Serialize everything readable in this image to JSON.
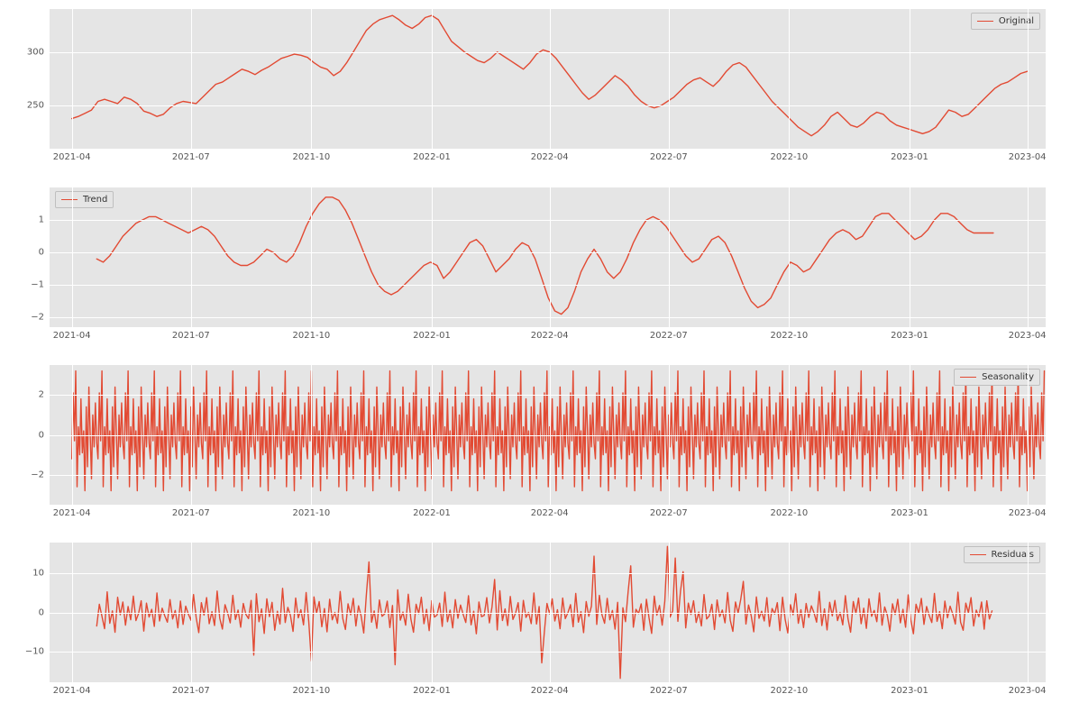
{
  "chart_data": [
    {
      "type": "line",
      "legend": "Original",
      "xlabel": "",
      "ylabel": "",
      "xticks": [
        "2021-04",
        "2021-07",
        "2021-10",
        "2022-01",
        "2022-04",
        "2022-07",
        "2022-10",
        "2023-01",
        "2023-04"
      ],
      "yticks": [
        250,
        300
      ],
      "xlim": [
        "2021-03-15",
        "2023-04-15"
      ],
      "ylim": [
        210,
        340
      ],
      "x_step_days": 5,
      "x_start": "2021-04-01",
      "values": [
        238,
        240,
        243,
        246,
        254,
        256,
        254,
        252,
        258,
        256,
        252,
        245,
        243,
        240,
        242,
        248,
        252,
        254,
        253,
        252,
        258,
        264,
        270,
        272,
        276,
        280,
        284,
        282,
        279,
        283,
        286,
        290,
        294,
        296,
        298,
        297,
        295,
        290,
        286,
        284,
        278,
        282,
        290,
        300,
        310,
        320,
        326,
        330,
        332,
        334,
        330,
        325,
        322,
        326,
        332,
        334,
        330,
        320,
        310,
        305,
        300,
        296,
        292,
        290,
        294,
        300,
        296,
        292,
        288,
        284,
        290,
        298,
        302,
        300,
        294,
        286,
        278,
        270,
        262,
        256,
        260,
        266,
        272,
        278,
        274,
        268,
        260,
        254,
        250,
        248,
        250,
        254,
        258,
        264,
        270,
        274,
        276,
        272,
        268,
        274,
        282,
        288,
        290,
        286,
        278,
        270,
        262,
        254,
        248,
        242,
        236,
        230,
        226,
        222,
        226,
        232,
        240,
        244,
        238,
        232,
        230,
        234,
        240,
        244,
        242,
        236,
        232,
        230,
        228,
        226,
        224,
        226,
        230,
        238,
        246,
        244,
        240,
        242,
        248,
        254,
        260,
        266,
        270,
        272,
        276,
        280,
        282
      ]
    },
    {
      "type": "line",
      "legend": "Trend",
      "xlabel": "",
      "ylabel": "",
      "xticks": [
        "2021-04",
        "2021-07",
        "2021-10",
        "2022-01",
        "2022-04",
        "2022-07",
        "2022-10",
        "2023-01",
        "2023-04"
      ],
      "yticks": [
        -2,
        -1,
        0,
        1
      ],
      "xlim": [
        "2021-03-15",
        "2023-04-15"
      ],
      "ylim": [
        -2.3,
        2.0
      ],
      "x_step_days": 5,
      "x_start": "2021-04-20",
      "values": [
        -0.2,
        -0.3,
        -0.1,
        0.2,
        0.5,
        0.7,
        0.9,
        1.0,
        1.1,
        1.1,
        1.0,
        0.9,
        0.8,
        0.7,
        0.6,
        0.7,
        0.8,
        0.7,
        0.5,
        0.2,
        -0.1,
        -0.3,
        -0.4,
        -0.4,
        -0.3,
        -0.1,
        0.1,
        0.0,
        -0.2,
        -0.3,
        -0.1,
        0.3,
        0.8,
        1.2,
        1.5,
        1.7,
        1.7,
        1.6,
        1.3,
        0.9,
        0.4,
        -0.1,
        -0.6,
        -1.0,
        -1.2,
        -1.3,
        -1.2,
        -1.0,
        -0.8,
        -0.6,
        -0.4,
        -0.3,
        -0.4,
        -0.8,
        -0.6,
        -0.3,
        0.0,
        0.3,
        0.4,
        0.2,
        -0.2,
        -0.6,
        -0.4,
        -0.2,
        0.1,
        0.3,
        0.2,
        -0.2,
        -0.8,
        -1.4,
        -1.8,
        -1.9,
        -1.7,
        -1.2,
        -0.6,
        -0.2,
        0.1,
        -0.2,
        -0.6,
        -0.8,
        -0.6,
        -0.2,
        0.3,
        0.7,
        1.0,
        1.1,
        1.0,
        0.8,
        0.5,
        0.2,
        -0.1,
        -0.3,
        -0.2,
        0.1,
        0.4,
        0.5,
        0.3,
        -0.1,
        -0.6,
        -1.1,
        -1.5,
        -1.7,
        -1.6,
        -1.4,
        -1.0,
        -0.6,
        -0.3,
        -0.4,
        -0.6,
        -0.5,
        -0.2,
        0.1,
        0.4,
        0.6,
        0.7,
        0.6,
        0.4,
        0.5,
        0.8,
        1.1,
        1.2,
        1.2,
        1.0,
        0.8,
        0.6,
        0.4,
        0.5,
        0.7,
        1.0,
        1.2,
        1.2,
        1.1,
        0.9,
        0.7,
        0.6,
        0.6,
        0.6,
        0.6
      ]
    },
    {
      "type": "line",
      "legend": "Seasonality",
      "xlabel": "",
      "ylabel": "",
      "xticks": [
        "2021-04",
        "2021-07",
        "2021-10",
        "2022-01",
        "2022-04",
        "2022-07",
        "2022-10",
        "2023-01",
        "2023-04"
      ],
      "yticks": [
        -2,
        0,
        2
      ],
      "xlim": [
        "2021-03-15",
        "2023-04-15"
      ],
      "ylim": [
        -3.5,
        3.5
      ],
      "x_step_days": 1,
      "x_start": "2021-04-01",
      "period": 20,
      "period_values": [
        -1.2,
        2.1,
        -0.3,
        3.2,
        -2.6,
        0.4,
        -1.0,
        1.8,
        -0.9,
        0.2,
        -2.8,
        1.4,
        -1.6,
        2.4,
        0.1,
        -2.2,
        1.0,
        -0.6,
        1.6,
        -0.4
      ]
    },
    {
      "type": "line",
      "legend": "Residuals",
      "xlabel": "",
      "ylabel": "",
      "xticks": [
        "2021-04",
        "2021-07",
        "2021-10",
        "2022-01",
        "2022-04",
        "2022-07",
        "2022-10",
        "2023-01",
        "2023-04"
      ],
      "yticks": [
        -10,
        0,
        10
      ],
      "xlim": [
        "2021-03-15",
        "2023-04-15"
      ],
      "ylim": [
        -18,
        18
      ],
      "x_step_days": 2,
      "x_start": "2021-04-20",
      "values": [
        -3.5,
        2.1,
        -1.0,
        -4.2,
        5.3,
        -2.8,
        0.4,
        -5.1,
        3.9,
        -0.6,
        2.7,
        -3.3,
        1.5,
        -1.9,
        4.2,
        -2.1,
        -0.3,
        3.0,
        -4.8,
        2.4,
        -1.2,
        0.8,
        -3.6,
        5.0,
        -2.2,
        1.1,
        -0.9,
        -2.5,
        3.3,
        -1.7,
        0.5,
        -4.0,
        2.9,
        -3.1,
        1.6,
        -0.4,
        -2.0,
        4.6,
        -1.3,
        -5.2,
        2.5,
        -0.7,
        3.8,
        -2.9,
        0.2,
        -3.4,
        5.5,
        -1.5,
        -4.3,
        2.0,
        -0.1,
        -2.7,
        4.4,
        -1.8,
        0.6,
        -3.8,
        2.3,
        -0.5,
        -1.6,
        3.1,
        -11.0,
        4.8,
        -2.4,
        0.9,
        -5.4,
        3.5,
        -1.1,
        2.6,
        -4.6,
        0.3,
        -3.0,
        6.2,
        -2.6,
        1.3,
        -0.8,
        -4.9,
        3.7,
        -1.4,
        0.7,
        -3.2,
        5.1,
        -2.3,
        -12.5,
        4.0,
        -0.2,
        2.8,
        -3.7,
        1.0,
        -5.0,
        3.4,
        -1.9,
        0.0,
        -2.8,
        5.4,
        -1.6,
        -4.4,
        2.2,
        -0.6,
        3.6,
        -3.5,
        1.7,
        -0.9,
        -5.3,
        4.5,
        13.0,
        -2.5,
        0.4,
        -4.1,
        3.2,
        -1.0,
        -0.4,
        2.9,
        -3.9,
        1.8,
        -13.5,
        5.8,
        -2.0,
        0.1,
        -3.3,
        4.7,
        -1.7,
        -5.1,
        2.1,
        -0.3,
        3.9,
        -2.9,
        0.8,
        -4.7,
        3.0,
        -1.2,
        -0.7,
        2.4,
        -3.6,
        5.2,
        -2.4,
        0.6,
        -4.0,
        3.3,
        -1.5,
        1.9,
        -0.5,
        -2.6,
        4.3,
        -3.2,
        0.3,
        -5.5,
        2.7,
        -1.1,
        -0.8,
        3.8,
        -2.7,
        1.4,
        8.5,
        -4.5,
        5.6,
        -2.1,
        0.9,
        -3.4,
        4.1,
        -1.8,
        -0.2,
        2.5,
        -4.8,
        3.1,
        -1.3,
        0.0,
        -2.9,
        5.0,
        -3.0,
        1.5,
        -13.0,
        -5.0,
        2.3,
        -0.4,
        3.5,
        -2.2,
        0.7,
        -4.2,
        3.7,
        -1.6,
        -0.1,
        2.0,
        -3.7,
        4.9,
        -2.5,
        0.2,
        -5.2,
        2.8,
        -1.0,
        1.6,
        14.5,
        -3.1,
        4.4,
        -0.6,
        -2.8,
        3.6,
        -1.9,
        0.5,
        -4.3,
        2.6,
        -17.0,
        1.2,
        -2.4,
        5.3,
        12.0,
        -3.8,
        0.8,
        -0.3,
        2.2,
        -4.6,
        3.4,
        -1.4,
        -5.4,
        4.2,
        -0.7,
        1.8,
        -3.3,
        2.9,
        17.0,
        -1.2,
        0.4,
        14.0,
        -2.3,
        5.5,
        10.5,
        -4.0,
        2.4,
        -0.5,
        3.0,
        -2.6,
        0.1,
        -3.5,
        4.6,
        -1.7,
        -0.9,
        2.1,
        -4.4,
        3.2,
        -1.1,
        0.6,
        -2.7,
        5.1,
        -2.0,
        -4.9,
        2.7,
        -0.2,
        3.3,
        8.0,
        -3.0,
        1.9,
        -0.8,
        -5.0,
        4.0,
        -1.5,
        0.3,
        -2.2,
        3.8,
        -3.6,
        1.0,
        -0.4,
        2.5,
        -4.7,
        3.9,
        -1.8,
        -5.3,
        2.0,
        -0.6,
        4.8,
        -2.8,
        0.7,
        -3.9,
        2.3,
        -1.3,
        1.7,
        -0.1,
        -2.5,
        5.4,
        -3.4,
        0.9,
        -4.5,
        2.6,
        -0.9,
        3.1,
        -2.1,
        0.0,
        -3.2,
        4.3,
        -1.6,
        -5.1,
        2.8,
        -0.3,
        3.7,
        -2.9,
        1.1,
        -4.1,
        3.5,
        -1.0,
        0.5,
        -2.4,
        5.0,
        -3.3,
        1.4,
        -0.7,
        -4.8,
        2.2,
        -0.5,
        3.4,
        -2.7,
        0.8,
        -3.8,
        4.5,
        -1.9,
        -5.5,
        2.1,
        -0.2,
        3.6,
        -3.1,
        1.5,
        -0.8,
        -2.6,
        4.9,
        -2.3,
        0.2,
        -4.2,
        2.9,
        -1.4,
        1.6,
        -0.4,
        -3.0,
        5.2,
        -2.5,
        -4.6,
        2.4,
        -0.1,
        3.8,
        -3.5,
        0.6,
        -1.1,
        2.7,
        -4.3,
        3.0,
        -1.7,
        0.4
      ]
    }
  ],
  "layout": {
    "subplot_tops": [
      10,
      208,
      405,
      602
    ],
    "subplot_height": 155
  }
}
